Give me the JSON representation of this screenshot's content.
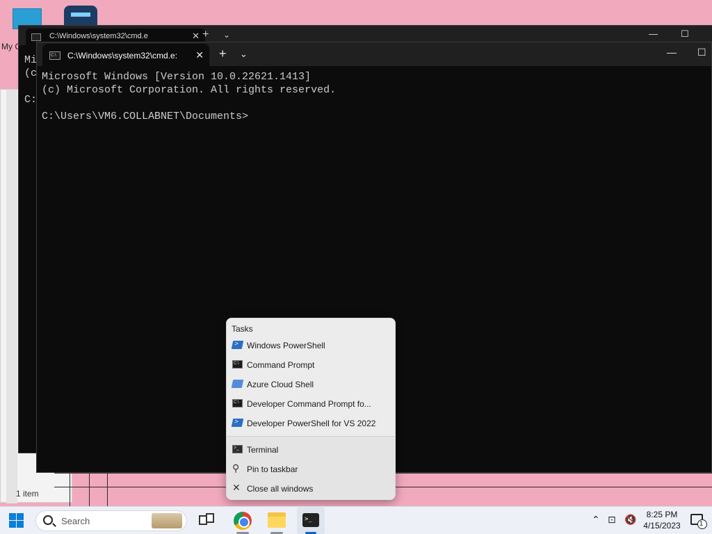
{
  "desktop": {
    "icon_label_partial": "My C",
    "explorer_status": "1 item"
  },
  "back_window": {
    "tab_title": "C:\\Windows\\system32\\cmd.e",
    "console_lines": [
      "Mi",
      "(c",
      "",
      "C:"
    ]
  },
  "front_window": {
    "tab_title": "C:\\Windows\\system32\\cmd.e:",
    "new_tab": "+",
    "dropdown": "⌄",
    "minimize": "—",
    "maximize": "☐",
    "console": [
      "Microsoft Windows [Version 10.0.22621.1413]",
      "(c) Microsoft Corporation. All rights reserved.",
      "",
      "C:\\Users\\VM6.COLLABNET\\Documents>"
    ]
  },
  "jumplist": {
    "header": "Tasks",
    "tasks": [
      {
        "label": "Windows PowerShell",
        "icon": "powershell-icon"
      },
      {
        "label": "Command Prompt",
        "icon": "cmd-icon"
      },
      {
        "label": "Azure Cloud Shell",
        "icon": "azure-icon"
      },
      {
        "label": "Developer Command Prompt fo...",
        "icon": "cmd-icon"
      },
      {
        "label": "Developer PowerShell for VS 2022",
        "icon": "powershell-icon"
      }
    ],
    "actions": [
      {
        "label": "Terminal",
        "icon": "terminal-icon"
      },
      {
        "label": "Pin to taskbar",
        "icon": "pin-icon"
      },
      {
        "label": "Close all windows",
        "icon": "close-icon"
      }
    ]
  },
  "taskbar": {
    "search_placeholder": "Search",
    "time": "8:25 PM",
    "date": "4/15/2023",
    "notification_count": "1"
  }
}
